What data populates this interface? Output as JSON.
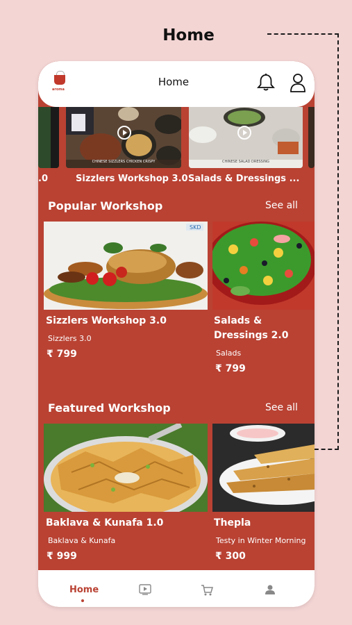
{
  "page": {
    "heading": "Home"
  },
  "app": {
    "header_title": "Home",
    "logo_text": "aroma"
  },
  "videos": [
    {
      "label": ".0",
      "caption": ""
    },
    {
      "label": "Sizzlers Workshop 3.0",
      "caption": "CHINESE SIZZLERS CHICKEN CRISPY"
    },
    {
      "label": "Salads & Dressings ...",
      "caption": "CHINESE SALAD DRESSING"
    }
  ],
  "popular": {
    "title": "Popular Workshop",
    "see_all": "See all",
    "cards": [
      {
        "title": "Sizzlers Workshop 3.0",
        "subtitle": "Sizzlers 3.0",
        "price": "₹ 799"
      },
      {
        "title": "Salads & Dressings 2.0",
        "subtitle": "Salads",
        "price": "₹ 799"
      }
    ]
  },
  "featured": {
    "title": "Featured Workshop",
    "see_all": "See all",
    "cards": [
      {
        "title": "Baklava & Kunafa 1.0",
        "subtitle": "Baklava & Kunafa",
        "price": "₹ 999"
      },
      {
        "title": "Thepla",
        "subtitle": "Testy in Winter Morning",
        "price": "₹ 300"
      }
    ]
  },
  "nav": {
    "home_label": "Home"
  },
  "colors": {
    "brand": "#b94233",
    "page_bg": "#f3d5d4",
    "header_bg": "#ffffff"
  }
}
